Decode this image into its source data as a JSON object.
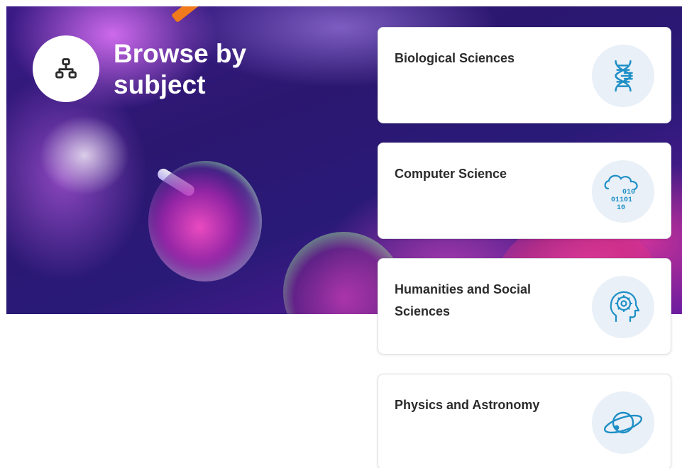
{
  "header": {
    "title": "Browse by subject",
    "icon": "hierarchy-icon"
  },
  "subjects": [
    {
      "label": "Biological Sciences",
      "icon": "dna-icon"
    },
    {
      "label": "Computer Science",
      "icon": "cloud-binary-icon"
    },
    {
      "label": "Humanities and Social Sciences",
      "icon": "head-gear-icon"
    },
    {
      "label": "Physics and Astronomy",
      "icon": "planet-icon"
    }
  ],
  "colors": {
    "accent": "#1f8fc6",
    "icon_bg": "#e9f0f7",
    "card_text": "#2b2b2b",
    "hero_dark": "#2b1770"
  }
}
